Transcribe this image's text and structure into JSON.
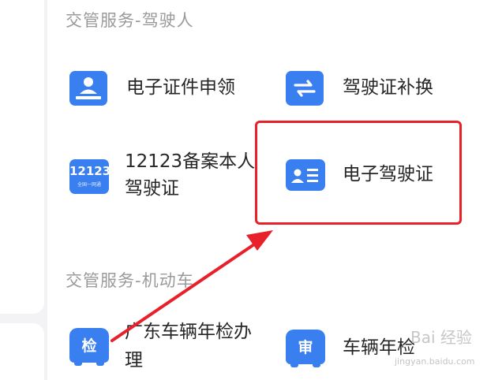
{
  "sections": [
    {
      "title": "交管服务-驾驶人",
      "items": [
        {
          "label": "电子证件申领",
          "icon": "id-card-upload-icon"
        },
        {
          "label": "驾驶证补换",
          "icon": "exchange-arrows-icon"
        },
        {
          "label_line1": "12123备案本人",
          "label_line2": "驾驶证",
          "icon": "12123-logo-icon",
          "icon_text": "12123",
          "icon_sub": "全国一网通"
        },
        {
          "label": "电子驾驶证",
          "icon": "driver-license-card-icon"
        }
      ]
    },
    {
      "title": "交管服务-机动车",
      "items": [
        {
          "label_line1": "广东车辆年检办",
          "label_line2": "理",
          "icon": "car-inspection-icon",
          "icon_text": "检"
        },
        {
          "label": "车辆年检",
          "icon": "car-review-icon",
          "icon_text": "审"
        }
      ]
    }
  ],
  "colors": {
    "accent": "#3a7ff0",
    "highlight": "#e8202a",
    "arrow": "#e8202a"
  },
  "watermark": {
    "text": "Bai 经验",
    "sub": "jingyan.baidu.com"
  }
}
